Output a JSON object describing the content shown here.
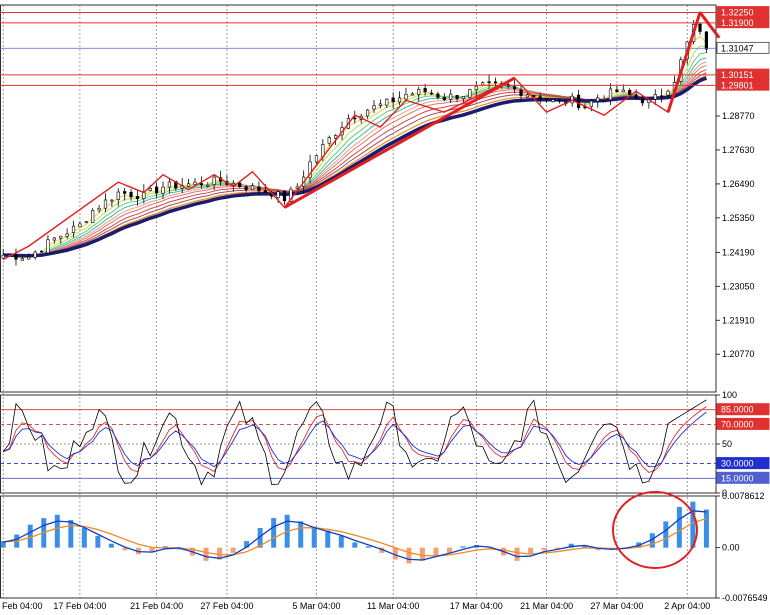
{
  "colors": {
    "background": "#ffffff",
    "grid": "#777777",
    "candle": "#000000",
    "ema_dark": "#1c1c6e",
    "ema_orange": "#f08a24",
    "level_red": "#e03030",
    "level_blue": "#5060d0",
    "zigzag": "#e02020",
    "macd_line": "#1040c0",
    "macd_signal": "#f08a24",
    "hist_pos": "#3c8fe8",
    "hist_neg": "#f2a07a",
    "stoch_main": "#000000",
    "stoch_blue": "#2030d0",
    "stoch_red": "#e03030",
    "circle": "#e02020"
  },
  "chart_data": [
    {
      "type": "candlestick",
      "panel": "price",
      "ylim": [
        1.195,
        1.325
      ],
      "y_ticks": [
        "1.28770",
        "1.27630",
        "1.26490",
        "1.25350",
        "1.24190",
        "1.23050",
        "1.21910",
        "1.20770"
      ],
      "levels": [
        {
          "label": "1.32250",
          "value": 1.3225,
          "color": "#e03030"
        },
        {
          "label": "1.31900",
          "value": 1.319,
          "color": "#e03030"
        },
        {
          "label": "1.31047",
          "value": 1.31047,
          "color": "#5060d0",
          "current": true
        },
        {
          "label": "1.30151",
          "value": 1.30151,
          "color": "#e03030"
        },
        {
          "label": "1.29801",
          "value": 1.29801,
          "color": "#e03030"
        }
      ],
      "close_path": [
        [
          0,
          1.241
        ],
        [
          4,
          1.2405
        ],
        [
          8,
          1.2465
        ],
        [
          12,
          1.251
        ],
        [
          14,
          1.256
        ],
        [
          18,
          1.262
        ],
        [
          22,
          1.261
        ],
        [
          25,
          1.264
        ],
        [
          30,
          1.265
        ],
        [
          34,
          1.266
        ],
        [
          38,
          1.264
        ],
        [
          42,
          1.262
        ],
        [
          44,
          1.26
        ],
        [
          46,
          1.264
        ],
        [
          48,
          1.272
        ],
        [
          51,
          1.28
        ],
        [
          54,
          1.287
        ],
        [
          57,
          1.29
        ],
        [
          60,
          1.292
        ],
        [
          63,
          1.295
        ],
        [
          66,
          1.296
        ],
        [
          69,
          1.294
        ],
        [
          72,
          1.295
        ],
        [
          75,
          1.2975
        ],
        [
          78,
          1.298
        ],
        [
          81,
          1.296
        ],
        [
          84,
          1.294
        ],
        [
          87,
          1.292
        ],
        [
          89,
          1.293
        ],
        [
          91,
          1.291
        ],
        [
          93,
          1.294
        ],
        [
          96,
          1.296
        ],
        [
          99,
          1.294
        ],
        [
          101,
          1.2925
        ],
        [
          103,
          1.295
        ],
        [
          105,
          1.3
        ],
        [
          107,
          1.312
        ],
        [
          108,
          1.318
        ],
        [
          109,
          1.315
        ],
        [
          110,
          1.311
        ]
      ],
      "x_ticks": [
        "Feb 04:00",
        "17 Feb 04:00",
        "21 Feb 04:00",
        "27 Feb 04:00",
        "5 Mar 04:00",
        "11 Mar 04:00",
        "17 Mar 04:00",
        "21 Mar 04:00",
        "27 Mar 04:00",
        "2 Apr 04:00"
      ],
      "x_tick_positions": [
        0,
        12,
        24,
        35,
        49,
        61,
        74,
        85,
        96,
        107
      ]
    },
    {
      "type": "line",
      "panel": "stochastic",
      "ylim": [
        0,
        100
      ],
      "y_ticks": [
        "100",
        "50",
        "0"
      ],
      "levels": [
        {
          "label": "85.0000",
          "value": 85,
          "color": "#e03030"
        },
        {
          "label": "70.0000",
          "value": 70,
          "color": "#e03030"
        },
        {
          "label": "30.0000",
          "value": 30,
          "color": "#2030d0"
        },
        {
          "label": "15.0000",
          "value": 15,
          "color": "#5060d0"
        }
      ]
    },
    {
      "type": "bar",
      "panel": "macd",
      "ylim": [
        -0.0076549,
        0.0078612
      ],
      "y_ticks": [
        "0.0078612",
        "0.00",
        "-0.0076549"
      ],
      "series": [
        {
          "values": [
            0.001,
            0.002,
            0.0035,
            0.0045,
            0.005,
            0.0042,
            0.003,
            0.0018,
            0.0006,
            -0.0004,
            -0.001,
            -0.0006,
            0.0002,
            -0.0003,
            -0.0012,
            -0.002,
            -0.0018,
            -0.0008,
            0.001,
            0.003,
            0.0045,
            0.005,
            0.004,
            0.0032,
            0.0026,
            0.0018,
            0.0008,
            0.0002,
            -0.0008,
            -0.0018,
            -0.0024,
            -0.002,
            -0.0012,
            -0.0008,
            0.0002,
            0.0004,
            -0.0002,
            -0.0012,
            -0.002,
            -0.001,
            -0.0004,
            -0.0002,
            0.0006,
            0.0002,
            -0.0004,
            -0.0002,
            0.0,
            0.0008,
            0.0022,
            0.004,
            0.0062,
            0.007,
            0.0058
          ]
        }
      ]
    }
  ]
}
